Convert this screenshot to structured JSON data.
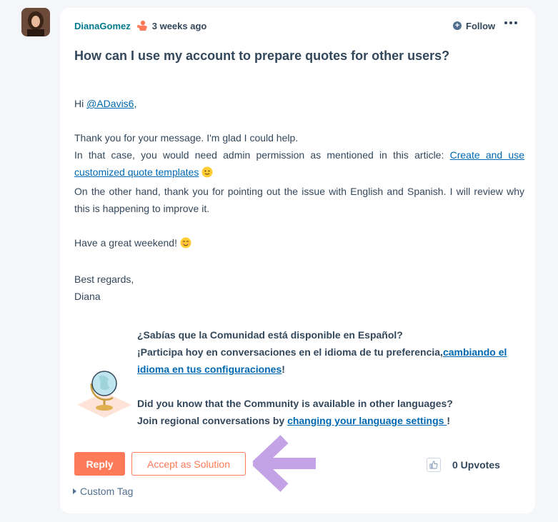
{
  "post": {
    "author": "DianaGomez",
    "time": "3 weeks ago",
    "follow_label": "Follow",
    "title": "How can I use my account to prepare quotes for other users?"
  },
  "message": {
    "greeting_prefix": "Hi ",
    "mention": "@ADavis6",
    "greeting_suffix": ",",
    "line1": "Thank you for your message. I'm glad I could help.",
    "line2_prefix": "In that case, you would need admin permission as mentioned in this article: ",
    "article_link": "Create and use customized quote templates",
    "line3": "On the other hand, thank you for pointing out the issue with English and Spanish. I will review why this is happening to improve it.",
    "line4": "Have a great weekend!",
    "closing": "Best regards,",
    "signature": "Diana"
  },
  "promo": {
    "es_line1": "¿Sabías que la Comunidad está disponible en Español?",
    "es_line2_prefix": "¡Participa hoy en conversaciones en el idioma de tu preferencia,",
    "es_link": "cambiando el idioma en tus configuraciones",
    "es_line2_suffix": "!",
    "en_line1": "Did you know that the Community is available in other languages?",
    "en_line2_prefix": "Join regional conversations by ",
    "en_link": "changing your language settings ",
    "en_line2_suffix": "!"
  },
  "actions": {
    "reply_label": "Reply",
    "accept_label": "Accept as Solution",
    "upvotes": "0 Upvotes",
    "custom_tag": "Custom Tag"
  },
  "colors": {
    "accent": "#ff7a59",
    "link": "#0068b1",
    "username": "#007a8c",
    "arrow": "#b48ce0"
  }
}
